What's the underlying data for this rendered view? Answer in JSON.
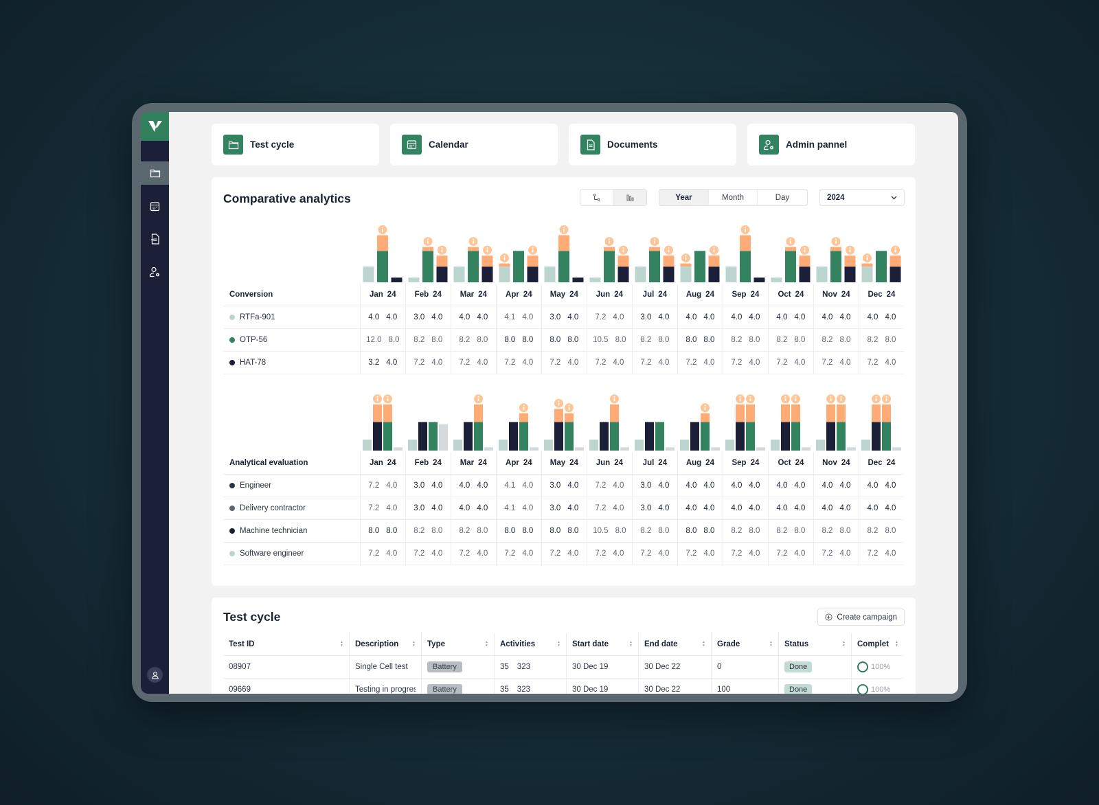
{
  "sidebar": {
    "logo": "logo-icon",
    "items": [
      {
        "name": "test-cycle",
        "icon": "folder-icon",
        "active": true
      },
      {
        "name": "calendar",
        "icon": "calendar-icon",
        "active": false
      },
      {
        "name": "documents",
        "icon": "document-icon",
        "active": false
      },
      {
        "name": "admin",
        "icon": "user-gear-icon",
        "active": false
      }
    ],
    "avatar": "user-icon"
  },
  "cards": [
    {
      "label": "Test cycle",
      "icon": "folder-icon"
    },
    {
      "label": "Calendar",
      "icon": "calendar-icon"
    },
    {
      "label": "Documents",
      "icon": "document-icon"
    },
    {
      "label": "Admin pannel",
      "icon": "user-gear-icon"
    }
  ],
  "analytics": {
    "title": "Comparative analytics",
    "view_toggle": [
      "line-chart-icon",
      "bar-chart-icon"
    ],
    "view_selected": 1,
    "periods": [
      "Year",
      "Month",
      "Day"
    ],
    "period_selected": "Year",
    "year_select": "2024",
    "months": [
      "Jan",
      "Feb",
      "Mar",
      "Apr",
      "May",
      "Jun",
      "Jul",
      "Aug",
      "Sep",
      "Oct",
      "Nov",
      "Dec"
    ],
    "year_suffix": "24",
    "colors": {
      "light": "#bcd6cf",
      "green": "#348360",
      "navy": "#1b1f38",
      "orange": "#ffab76",
      "grey": "#d7dadc",
      "pale": "#eef1f1"
    },
    "conversion": {
      "heading": "Conversion",
      "rows": [
        {
          "label": "RTFa-901",
          "color": "#bcd6cf",
          "values": [
            [
              "4.0",
              "4.0"
            ],
            [
              "3.0",
              "4.0"
            ],
            [
              "4.0",
              "4.0"
            ],
            [
              "4.1",
              "4.0"
            ],
            [
              "3.0",
              "4.0"
            ],
            [
              "7.2",
              "4.0"
            ],
            [
              "3.0",
              "4.0"
            ],
            [
              "4.0",
              "4.0"
            ],
            [
              "4.0",
              "4.0"
            ],
            [
              "4.0",
              "4.0"
            ],
            [
              "4.0",
              "4.0"
            ],
            [
              "4.0",
              "4.0"
            ]
          ]
        },
        {
          "label": "OTP-56",
          "color": "#348360",
          "values": [
            [
              "12.0",
              "8.0"
            ],
            [
              "8.2",
              "8.0"
            ],
            [
              "8.2",
              "8.0"
            ],
            [
              "8.0",
              "8.0"
            ],
            [
              "8.0",
              "8.0"
            ],
            [
              "10.5",
              "8.0"
            ],
            [
              "8.2",
              "8.0"
            ],
            [
              "8.0",
              "8.0"
            ],
            [
              "8.2",
              "8.0"
            ],
            [
              "8.2",
              "8.0"
            ],
            [
              "8.2",
              "8.0"
            ],
            [
              "8.2",
              "8.0"
            ]
          ]
        },
        {
          "label": "HAT-78",
          "color": "#1b1f38",
          "values": [
            [
              "3.2",
              "4.0"
            ],
            [
              "7.2",
              "4.0"
            ],
            [
              "7.2",
              "4.0"
            ],
            [
              "7.2",
              "4.0"
            ],
            [
              "7.2",
              "4.0"
            ],
            [
              "7.2",
              "4.0"
            ],
            [
              "7.2",
              "4.0"
            ],
            [
              "7.2",
              "4.0"
            ],
            [
              "7.2",
              "4.0"
            ],
            [
              "7.2",
              "4.0"
            ],
            [
              "7.2",
              "4.0"
            ],
            [
              "7.2",
              "4.0"
            ]
          ]
        }
      ]
    },
    "evaluation": {
      "heading": "Analytical evaluation",
      "rows": [
        {
          "label": "Engineer",
          "color": "#2b3546",
          "values": [
            [
              "7.2",
              "4.0"
            ],
            [
              "3.0",
              "4.0"
            ],
            [
              "4.0",
              "4.0"
            ],
            [
              "4.1",
              "4.0"
            ],
            [
              "3.0",
              "4.0"
            ],
            [
              "7.2",
              "4.0"
            ],
            [
              "3.0",
              "4.0"
            ],
            [
              "4.0",
              "4.0"
            ],
            [
              "4.0",
              "4.0"
            ],
            [
              "4.0",
              "4.0"
            ],
            [
              "4.0",
              "4.0"
            ],
            [
              "4.0",
              "4.0"
            ]
          ]
        },
        {
          "label": "Delivery contractor",
          "color": "#5f656f",
          "values": [
            [
              "7.2",
              "4.0"
            ],
            [
              "3.0",
              "4.0"
            ],
            [
              "4.0",
              "4.0"
            ],
            [
              "4.1",
              "4.0"
            ],
            [
              "3.0",
              "4.0"
            ],
            [
              "7.2",
              "4.0"
            ],
            [
              "3.0",
              "4.0"
            ],
            [
              "4.0",
              "4.0"
            ],
            [
              "4.0",
              "4.0"
            ],
            [
              "4.0",
              "4.0"
            ],
            [
              "4.0",
              "4.0"
            ],
            [
              "4.0",
              "4.0"
            ]
          ]
        },
        {
          "label": "Machine technician",
          "color": "#1b1f38",
          "values": [
            [
              "8.0",
              "8.0"
            ],
            [
              "8.2",
              "8.0"
            ],
            [
              "8.2",
              "8.0"
            ],
            [
              "8.0",
              "8.0"
            ],
            [
              "8.0",
              "8.0"
            ],
            [
              "10.5",
              "8.0"
            ],
            [
              "8.2",
              "8.0"
            ],
            [
              "8.0",
              "8.0"
            ],
            [
              "8.2",
              "8.0"
            ],
            [
              "8.2",
              "8.0"
            ],
            [
              "8.2",
              "8.0"
            ],
            [
              "8.2",
              "8.0"
            ]
          ]
        },
        {
          "label": "Software engineer",
          "color": "#bcd6cf",
          "values": [
            [
              "7.2",
              "4.0"
            ],
            [
              "7.2",
              "4.0"
            ],
            [
              "7.2",
              "4.0"
            ],
            [
              "7.2",
              "4.0"
            ],
            [
              "7.2",
              "4.0"
            ],
            [
              "7.2",
              "4.0"
            ],
            [
              "7.2",
              "4.0"
            ],
            [
              "7.2",
              "4.0"
            ],
            [
              "7.2",
              "4.0"
            ],
            [
              "7.2",
              "4.0"
            ],
            [
              "7.2",
              "4.0"
            ],
            [
              "7.2",
              "4.0"
            ]
          ]
        }
      ]
    }
  },
  "chart_data": [
    {
      "type": "bar",
      "title": "Conversion",
      "categories": [
        "Jan 24",
        "Feb 24",
        "Mar 24",
        "Apr 24",
        "May 24",
        "Jun 24",
        "Jul 24",
        "Aug 24",
        "Sep 24",
        "Oct 24",
        "Nov 24",
        "Dec 24"
      ],
      "series": [
        {
          "name": "RTFa-901",
          "color": "#bcd6cf",
          "values": [
            2,
            0.6,
            2,
            2,
            2,
            0.6,
            2,
            2,
            2,
            0.6,
            2,
            2
          ],
          "alert": [
            0,
            0,
            0,
            0.4,
            0,
            0,
            0,
            0.4,
            0,
            0,
            0,
            0.4
          ]
        },
        {
          "name": "OTP-56",
          "color": "#348360",
          "values": [
            4,
            4,
            4,
            4,
            4,
            4,
            4,
            4,
            4,
            4,
            4,
            4
          ],
          "alert": [
            2,
            0.5,
            0.5,
            0,
            2,
            0.5,
            0.5,
            0,
            2,
            0.5,
            0.5,
            0
          ]
        },
        {
          "name": "HAT-78",
          "color": "#1b1f38",
          "values": [
            0.6,
            2,
            2,
            2,
            0.6,
            2,
            2,
            2,
            0.6,
            2,
            2,
            2
          ],
          "alert": [
            0,
            1.4,
            1.4,
            1.4,
            0,
            1.4,
            1.4,
            1.4,
            0,
            1.4,
            1.4,
            1.4
          ]
        }
      ],
      "alert_color": "#ffab76",
      "ylim": [
        0,
        7
      ]
    },
    {
      "type": "bar",
      "title": "Analytical evaluation",
      "categories": [
        "Jan 24",
        "Feb 24",
        "Mar 24",
        "Apr 24",
        "May 24",
        "Jun 24",
        "Jul 24",
        "Aug 24",
        "Sep 24",
        "Oct 24",
        "Nov 24",
        "Dec 24"
      ],
      "series": [
        {
          "name": "Software engineer",
          "color": "#bcd6cf",
          "values": [
            1,
            1,
            1,
            1,
            1,
            1,
            1,
            1,
            1,
            1,
            1,
            1
          ],
          "alert": [
            0,
            0,
            0,
            0,
            0,
            0,
            0,
            0,
            0,
            0,
            0,
            0
          ]
        },
        {
          "name": "Machine technician",
          "color": "#1b1f38",
          "values": [
            2.6,
            2.6,
            2.6,
            2.6,
            2.6,
            2.6,
            2.6,
            2.6,
            2.6,
            2.6,
            2.6,
            2.6
          ],
          "alert": [
            1.6,
            0,
            0,
            0,
            1.2,
            0,
            0,
            0,
            1.6,
            1.6,
            1.6,
            1.6
          ]
        },
        {
          "name": "Engineer",
          "color": "#348360",
          "values": [
            2.6,
            2.6,
            2.6,
            2.6,
            2.6,
            2.6,
            2.6,
            2.6,
            2.6,
            2.6,
            2.6,
            2.6
          ],
          "alert": [
            1.6,
            0,
            1.6,
            0.8,
            0.8,
            1.6,
            0,
            0.8,
            1.6,
            1.6,
            1.6,
            1.6
          ]
        },
        {
          "name": "Delivery contractor",
          "color": "#d7dadc",
          "values": [
            0.3,
            2.4,
            0.3,
            0.3,
            0.3,
            0.3,
            0.3,
            0.3,
            0.3,
            0.3,
            0.3,
            0.3
          ],
          "alert": [
            0,
            0,
            0,
            0,
            0,
            0,
            0,
            0,
            0,
            0,
            0,
            0
          ]
        }
      ],
      "alert_color": "#ffab76",
      "ylim": [
        0,
        5
      ]
    }
  ],
  "testcycle": {
    "title": "Test cycle",
    "create_label": "Create campaign",
    "columns": [
      "Test ID",
      "Description",
      "Type",
      "Activities",
      "Start date",
      "End date",
      "Grade",
      "Status",
      "Complet"
    ],
    "rows": [
      {
        "id": "08907",
        "description": "Single Cell test",
        "type": "Battery",
        "activities": [
          "35",
          "323"
        ],
        "start": "30 Dec 19",
        "end": "30 Dec 22",
        "grade": "0",
        "status": "Done",
        "complete": "100%"
      },
      {
        "id": "09669",
        "description": "Testing in progress",
        "type": "Battery",
        "activities": [
          "35",
          "323"
        ],
        "start": "30 Dec 19",
        "end": "30 Dec 22",
        "grade": "100",
        "status": "Done",
        "complete": "100%"
      }
    ]
  }
}
